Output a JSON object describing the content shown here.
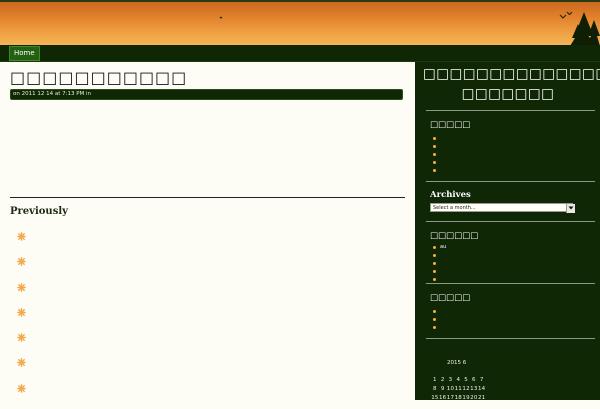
{
  "nav": {
    "items": [
      {
        "label": "Home"
      }
    ]
  },
  "post": {
    "title": "□□□□□□□□□□□",
    "meta": "on 2011 12 14  at 7:13 PM in"
  },
  "previously": {
    "heading": "Previously",
    "count": 7
  },
  "sidebar": {
    "blog_title": "□□□□□□□□□□□□□□□□□ □□□□□□□",
    "widget1": {
      "heading": "□□□□□",
      "items": [
        "",
        "",
        "",
        "",
        ""
      ]
    },
    "archives": {
      "heading": "Archives",
      "select_value": "Select a month..."
    },
    "widget3": {
      "heading": "□□□□□□",
      "items": [
        "au",
        "",
        "",
        "",
        ""
      ]
    },
    "widget4": {
      "heading": "□□□□□",
      "items": [
        "",
        "",
        ""
      ]
    },
    "calendar": {
      "caption": "2015 6",
      "rows": [
        [
          "1",
          "2",
          "3",
          "4",
          "5",
          "6",
          "7"
        ],
        [
          "8",
          "9",
          "10",
          "11",
          "12",
          "13",
          "14"
        ],
        [
          "15",
          "16",
          "17",
          "18",
          "19",
          "20",
          "21"
        ]
      ]
    }
  },
  "colors": {
    "header_top": "#c8651e",
    "header_bottom": "#f5b65a",
    "dark_green": "#0f2705",
    "asterisk": "#f3a94a",
    "page_bg": "#fdfdf6"
  },
  "icons": {
    "nav_left": "nav-home",
    "header_decor": "pine-trees-icon",
    "birds": "birds-icon",
    "bullet": "asterisk-icon"
  }
}
